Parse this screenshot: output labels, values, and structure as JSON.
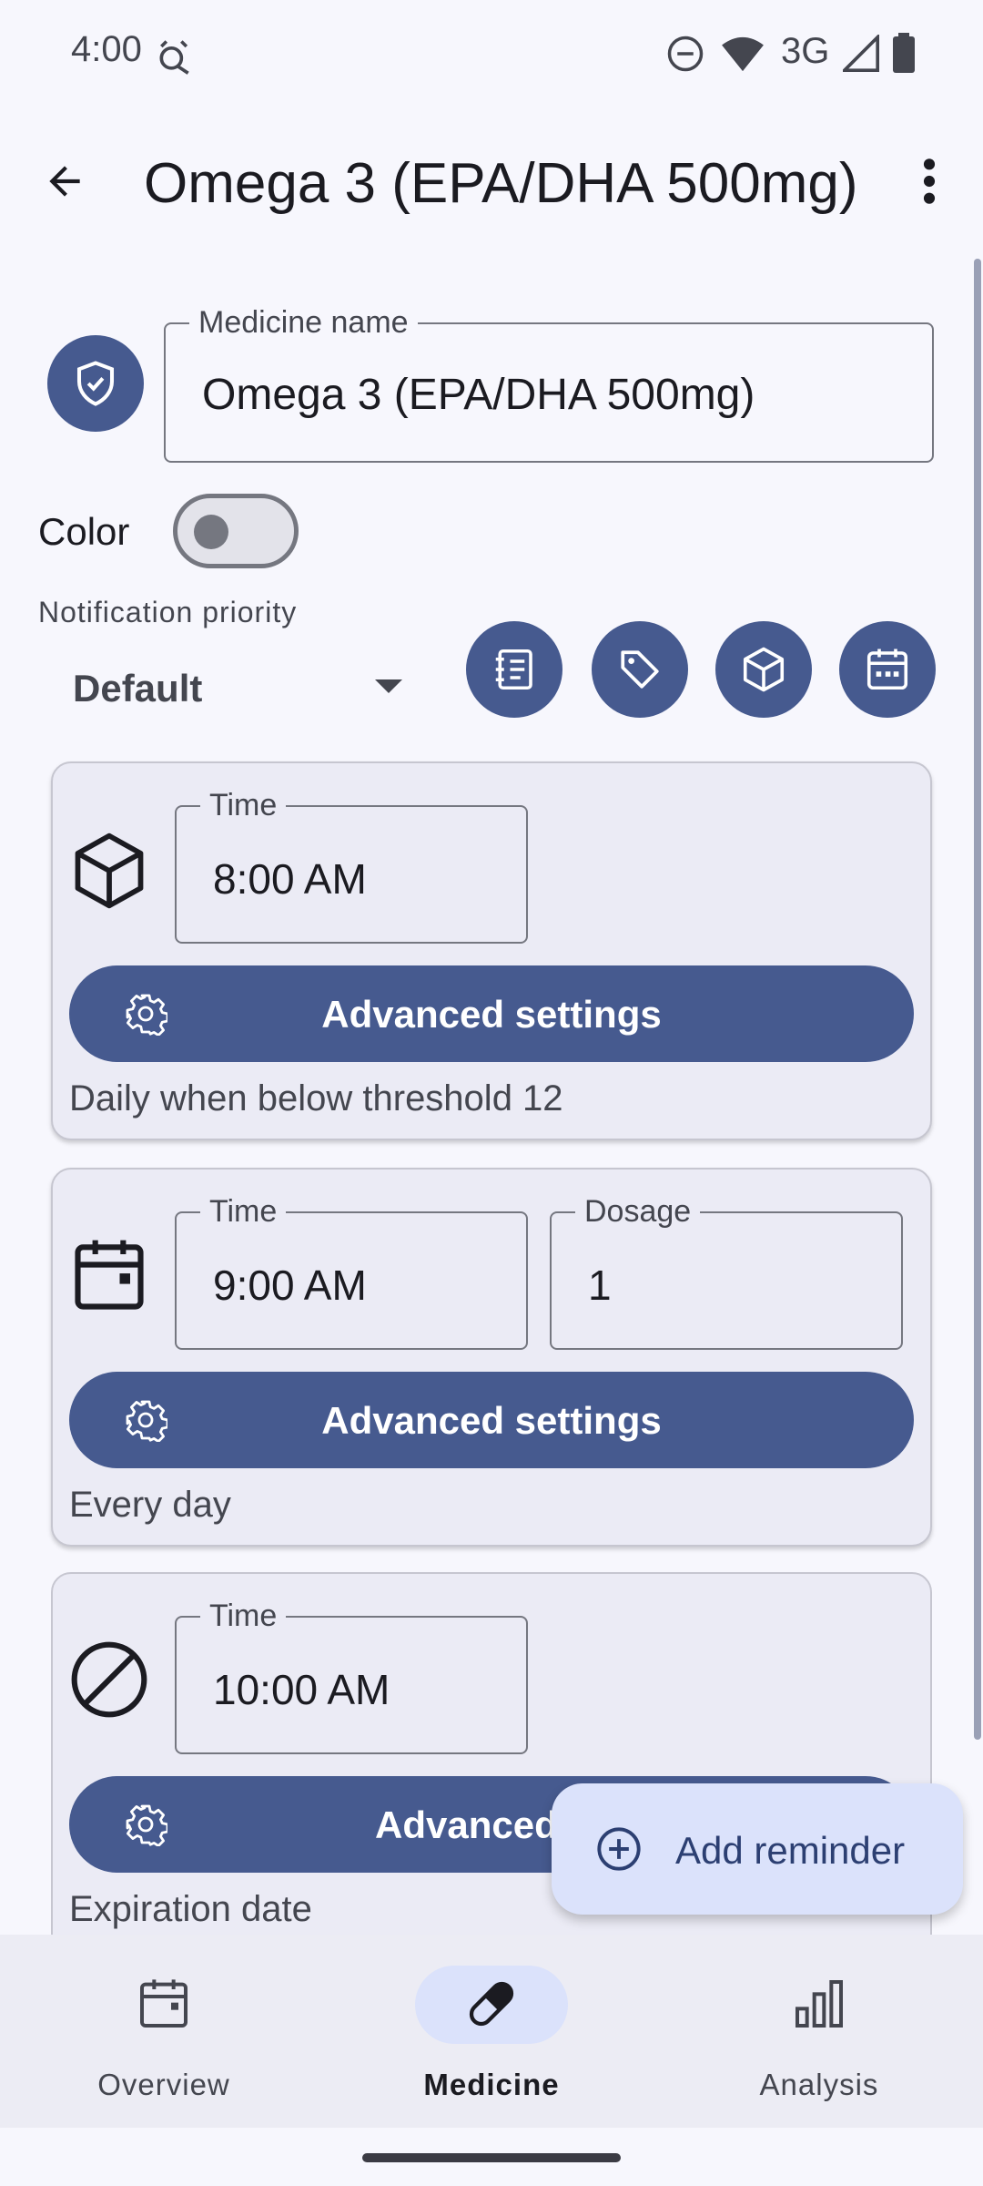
{
  "status_bar": {
    "time": "4:00",
    "network": "3G",
    "icons": [
      "alarm-icon",
      "do-not-disturb-icon",
      "wifi-icon",
      "signal-icon",
      "battery-icon"
    ]
  },
  "app_bar": {
    "title": "Omega 3 (EPA/DHA 500mg)",
    "back_icon": "arrow-back-icon",
    "more_icon": "more-vert-icon"
  },
  "medicine": {
    "name_label": "Medicine name",
    "name_value": "Omega 3 (EPA/DHA 500mg)",
    "color_label": "Color",
    "color_enabled": false,
    "priority_label": "Notification priority",
    "priority_value": "Default",
    "action_icons": [
      "notes-icon",
      "tag-icon",
      "box-icon",
      "calendar-icon"
    ]
  },
  "reminders": [
    {
      "icon": "box-icon",
      "time_label": "Time",
      "time_value": "8:00 AM",
      "button_label": "Advanced settings",
      "summary": "Daily when below threshold 12"
    },
    {
      "icon": "calendar-icon",
      "time_label": "Time",
      "time_value": "9:00 AM",
      "dosage_label": "Dosage",
      "dosage_value": "1",
      "button_label": "Advanced settings",
      "summary": "Every day"
    },
    {
      "icon": "block-icon",
      "time_label": "Time",
      "time_value": "10:00 AM",
      "button_label": "Advanced s",
      "summary": "Expiration date"
    }
  ],
  "fab": {
    "label": "Add reminder",
    "icon": "add-circle-icon"
  },
  "bottom_nav": {
    "items": [
      {
        "label": "Overview",
        "icon": "calendar-icon",
        "active": false
      },
      {
        "label": "Medicine",
        "icon": "pill-icon",
        "active": true
      },
      {
        "label": "Analysis",
        "icon": "bar-chart-icon",
        "active": false
      }
    ]
  },
  "colors": {
    "primary": "#465a8f",
    "background": "#f7f7fd",
    "card": "#ebebf5",
    "fab": "#dbe2fb"
  }
}
